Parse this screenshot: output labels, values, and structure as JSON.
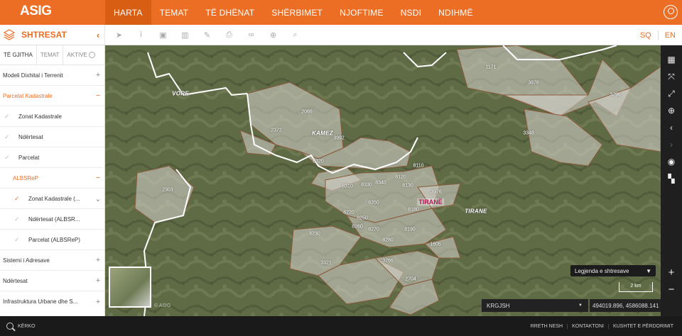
{
  "header": {
    "logo": "ASIG",
    "nav": [
      "HARTA",
      "TEMAT",
      "TË DHËNAT",
      "SHËRBIMET",
      "NJOFTIME",
      "NSDI",
      "NDIHMË"
    ],
    "active_nav": "HARTA"
  },
  "toolbar": {
    "panel_title": "SHTRESAT",
    "lang_sq": "SQ",
    "lang_en": "EN",
    "icons": [
      "pointer-icon",
      "info-icon",
      "select-box-icon",
      "chart-icon",
      "edit-icon",
      "print-icon",
      "link-icon",
      "add-icon",
      "search-icon"
    ]
  },
  "sidebar": {
    "tabs": [
      "TË GJITHA",
      "TEMAT",
      "AKTIVE"
    ],
    "rows": [
      {
        "label": "Modeli Dixhital i Terrenit",
        "toggle": "+"
      },
      {
        "label": "Parcelat Kadastrale",
        "toggle": "−"
      },
      {
        "label": "Zonat Kadastrale"
      },
      {
        "label": "Ndërtesat"
      },
      {
        "label": "Parcelat"
      },
      {
        "label": "ALBSReP",
        "toggle": "−"
      },
      {
        "label": "Zonat Kadastrale (..."
      },
      {
        "label": "Ndërtesat (ALBSR..."
      },
      {
        "label": "Parcelat (ALBSReP)"
      },
      {
        "label": "Sistemi i Adresave",
        "toggle": "+"
      },
      {
        "label": "Ndërtesat",
        "toggle": "+"
      },
      {
        "label": "Infrastruktura Urbane dhe S...",
        "toggle": "+"
      }
    ]
  },
  "map": {
    "places": {
      "vore": "VORE",
      "kamez": "KAMEZ",
      "tirane": "TIRANE",
      "tirane2": "TIRANË"
    },
    "parcels": [
      "1171",
      "3876",
      "3296",
      "3348",
      "2066",
      "2372",
      "3992",
      "8320",
      "2303",
      "8110",
      "8120",
      "8130",
      "8310",
      "8330",
      "8340",
      "3976",
      "8350",
      "8180",
      "8220",
      "8250",
      "8260",
      "8270",
      "8190",
      "8230",
      "8280",
      "1605",
      "3321",
      "3266",
      "2704"
    ],
    "legend_button": "Legjenda e shtresave",
    "scale": "2 km",
    "crs": "KRGJSH",
    "coords": "494019.896, 4586088.141",
    "watermark": "© ASIG"
  },
  "footer": {
    "search": "KËRKO",
    "links": [
      "RRETH NESH",
      "KONTAKTONI",
      "KUSHTET E PËRDORIMIT"
    ]
  }
}
